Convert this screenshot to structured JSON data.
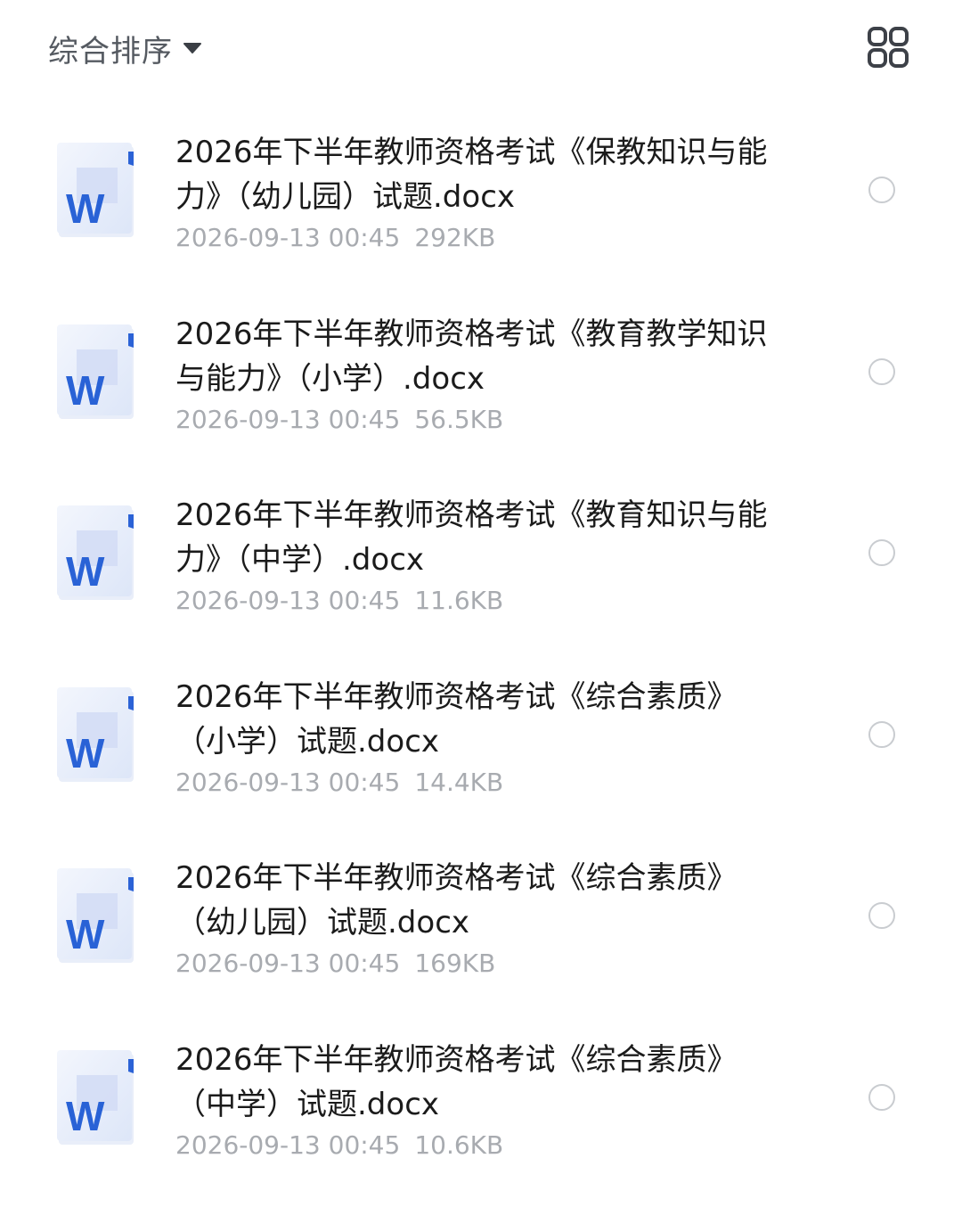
{
  "header": {
    "sort_label": "综合排序",
    "sort_caret_icon": "caret-down-icon",
    "view_toggle_icon": "grid-view-icon"
  },
  "colors": {
    "word_blue": "#2962d6",
    "meta_gray": "#a8abb0",
    "radio_border": "#c9ccd0"
  },
  "files": [
    {
      "name": "2026年下半年教师资格考试《保教知识与能力》（幼儿园）试题.docx",
      "date": "2026-09-13 00:45",
      "size": "292KB",
      "icon": "word-doc-icon"
    },
    {
      "name": "2026年下半年教师资格考试《教育教学知识与能力》（小学）.docx",
      "date": "2026-09-13 00:45",
      "size": "56.5KB",
      "icon": "word-doc-icon"
    },
    {
      "name": "2026年下半年教师资格考试《教育知识与能力》（中学）.docx",
      "date": "2026-09-13 00:45",
      "size": "11.6KB",
      "icon": "word-doc-icon"
    },
    {
      "name": "2026年下半年教师资格考试《综合素质》（小学）试题.docx",
      "date": "2026-09-13 00:45",
      "size": "14.4KB",
      "icon": "word-doc-icon"
    },
    {
      "name": "2026年下半年教师资格考试《综合素质》（幼儿园）试题.docx",
      "date": "2026-09-13 00:45",
      "size": "169KB",
      "icon": "word-doc-icon"
    },
    {
      "name": "2026年下半年教师资格考试《综合素质》（中学）试题.docx",
      "date": "2026-09-13 00:45",
      "size": "10.6KB",
      "icon": "word-doc-icon"
    }
  ]
}
